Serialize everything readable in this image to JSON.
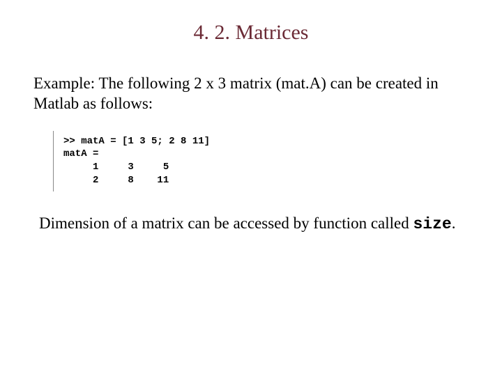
{
  "title": "4. 2. Matrices",
  "paragraph1": "Example: The following 2 x 3 matrix (mat.A) can be created in Matlab as follows:",
  "code": {
    "line1": ">> matA = [1 3 5; 2 8 11]",
    "blank1": "",
    "line2": "matA =",
    "blank2": "",
    "line3": "     1     3     5",
    "line4": "     2     8    11"
  },
  "paragraph2_prefix": "Dimension of a matrix can be accessed by function called ",
  "paragraph2_mono": "size",
  "paragraph2_suffix": "."
}
